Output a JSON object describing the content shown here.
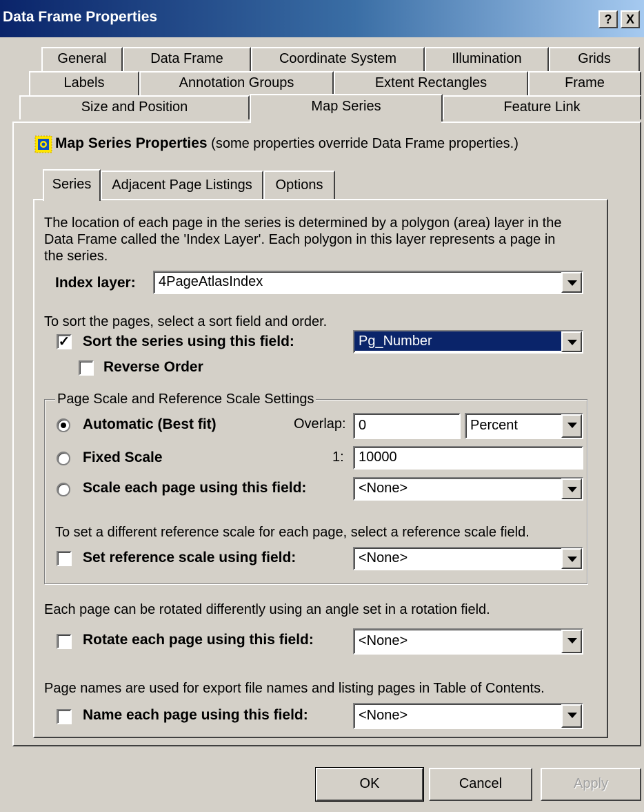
{
  "window": {
    "title": "Data Frame Properties",
    "help_label": "?",
    "close_label": "X"
  },
  "tabs": {
    "row1": [
      "General",
      "Data Frame",
      "Coordinate System",
      "Illumination",
      "Grids"
    ],
    "row2": [
      "Labels",
      "Annotation Groups",
      "Extent Rectangles",
      "Frame"
    ],
    "row3": [
      "Size and Position",
      "Map Series",
      "Feature Link"
    ],
    "selected": "Map Series"
  },
  "header": {
    "title": "Map Series Properties",
    "note": "(some properties override Data Frame properties.)",
    "icon": "map-series-icon"
  },
  "inner_tabs": {
    "items": [
      "Series",
      "Adjacent Page Listings",
      "Options"
    ],
    "selected": "Series"
  },
  "series": {
    "description": [
      "The location of each page in the series is determined by a polygon (area) layer in the",
      "Data Frame called the 'Index Layer'.  Each polygon in this layer represents a page in",
      "the series."
    ],
    "index_layer_label": "Index layer:",
    "index_layer_value": "4PageAtlasIndex",
    "sort_hint": "To sort the pages, select a sort field and order.",
    "sort_label": "Sort the series using this field:",
    "sort_checked": true,
    "sort_value": "Pg_Number",
    "reverse_label": "Reverse Order",
    "reverse_checked": false
  },
  "scale_group": {
    "title": "Page Scale and Reference Scale Settings",
    "automatic_label": "Automatic (Best fit)",
    "overlap_label": "Overlap:",
    "overlap_value": "0",
    "overlap_unit": "Percent",
    "fixed_label": "Fixed Scale",
    "fixed_prefix": "1:",
    "fixed_value": "10000",
    "field_label": "Scale each page using this field:",
    "field_value": "<None>",
    "selected": "automatic",
    "ref_hint": "To set a different reference scale for each page, select a reference scale field.",
    "ref_label": "Set reference scale using field:",
    "ref_checked": false,
    "ref_value": "<None>"
  },
  "rotation": {
    "hint": "Each page can be rotated differently using an angle set in a rotation field.",
    "label": "Rotate each page using this field:",
    "checked": false,
    "value": "<None>"
  },
  "naming": {
    "hint": "Page names are used for export file names and listing pages in Table of Contents.",
    "label": "Name each page using this field:",
    "checked": false,
    "value": "<None>"
  },
  "buttons": {
    "ok": "OK",
    "cancel": "Cancel",
    "apply": "Apply"
  }
}
